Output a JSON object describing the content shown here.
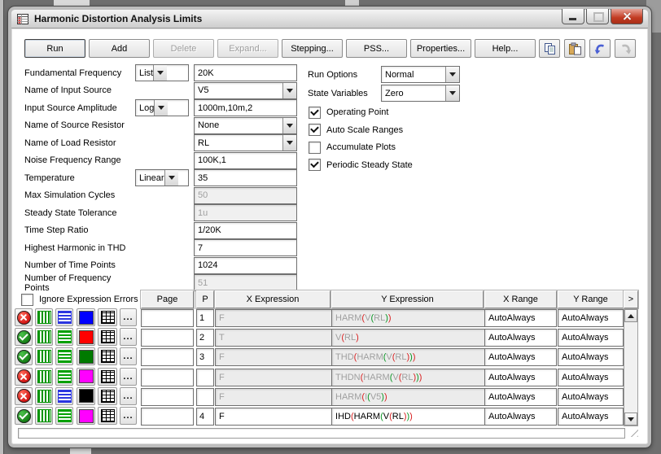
{
  "window": {
    "title": "Harmonic Distortion Analysis Limits"
  },
  "toolbar": {
    "buttons": [
      {
        "label": "Run",
        "enabled": true,
        "default": true
      },
      {
        "label": "Add",
        "enabled": true
      },
      {
        "label": "Delete",
        "enabled": false
      },
      {
        "label": "Expand...",
        "enabled": false
      },
      {
        "label": "Stepping...",
        "enabled": true
      },
      {
        "label": "PSS...",
        "enabled": true
      },
      {
        "label": "Properties...",
        "enabled": true
      },
      {
        "label": "Help...",
        "enabled": true
      }
    ],
    "icon_buttons": [
      {
        "name": "copy",
        "enabled": true
      },
      {
        "name": "paste",
        "enabled": true
      },
      {
        "name": "undo",
        "enabled": true
      },
      {
        "name": "redo",
        "enabled": false
      }
    ]
  },
  "form": {
    "fields": [
      {
        "label": "Fundamental Frequency",
        "method": "List",
        "value": "20K",
        "control": "text",
        "disabled": false
      },
      {
        "label": "Name of Input Source",
        "method": "",
        "value": "V5",
        "control": "select",
        "disabled": false
      },
      {
        "label": "Input Source Amplitude",
        "method": "Log",
        "value": "1000m,10m,2",
        "control": "text",
        "disabled": false
      },
      {
        "label": "Name of Source Resistor",
        "method": "",
        "value": "None",
        "control": "select",
        "disabled": false
      },
      {
        "label": "Name of Load Resistor",
        "method": "",
        "value": "RL",
        "control": "select",
        "disabled": false
      },
      {
        "label": "Noise Frequency Range",
        "method": "",
        "value": "100K,1",
        "control": "text",
        "disabled": false
      },
      {
        "label": "Temperature",
        "method": "Linear",
        "value": "35",
        "control": "text",
        "disabled": false
      },
      {
        "label": "Max Simulation Cycles",
        "method": "",
        "value": "50",
        "control": "text",
        "disabled": true
      },
      {
        "label": "Steady State Tolerance",
        "method": "",
        "value": "1u",
        "control": "text",
        "disabled": true
      },
      {
        "label": "Time Step Ratio",
        "method": "",
        "value": "1/20K",
        "control": "text",
        "disabled": false
      },
      {
        "label": "Highest Harmonic in THD",
        "method": "",
        "value": "7",
        "control": "text",
        "disabled": false
      },
      {
        "label": "Number of Time Points",
        "method": "",
        "value": "1024",
        "control": "text",
        "disabled": false
      },
      {
        "label": "Number of Frequency Points",
        "method": "",
        "value": "51",
        "control": "text",
        "disabled": true
      }
    ],
    "run_options_label": "Run Options",
    "run_options_value": "Normal",
    "state_variables_label": "State Variables",
    "state_variables_value": "Zero",
    "checkboxes": [
      {
        "label": "Operating Point",
        "checked": true
      },
      {
        "label": "Auto Scale Ranges",
        "checked": true
      },
      {
        "label": "Accumulate Plots",
        "checked": false
      },
      {
        "label": "Periodic Steady State",
        "checked": true
      }
    ]
  },
  "table": {
    "ignore_label": "Ignore Expression Errors",
    "ignore_checked": false,
    "columns": {
      "page": "Page",
      "p": "P",
      "x_expression": "X Expression",
      "y_expression": "Y Expression",
      "x_range": "X Range",
      "y_range": "Y Range",
      "more": ">"
    },
    "dots_label": "...",
    "paren_colors": [
      "#d81f1f",
      "#089422"
    ],
    "disabled_text": "#9f9f9f",
    "rows": [
      {
        "enabled": false,
        "hatch_color": "#009400",
        "lines_color": "#2b35e0",
        "curve_color": "#0000ff",
        "page": "",
        "p": "1",
        "x": "F",
        "y": "HARM(V(RL))",
        "x_range": "AutoAlways",
        "y_range": "AutoAlways",
        "active": false
      },
      {
        "enabled": true,
        "hatch_color": "#009400",
        "lines_color": "#00a000",
        "curve_color": "#ff0000",
        "page": "",
        "p": "2",
        "x": "T",
        "y": "V(RL)",
        "x_range": "AutoAlways",
        "y_range": "AutoAlways",
        "active": false
      },
      {
        "enabled": true,
        "hatch_color": "#009400",
        "lines_color": "#00a000",
        "curve_color": "#007a00",
        "page": "",
        "p": "3",
        "x": "F",
        "y": "THD(HARM(V(RL)))",
        "x_range": "AutoAlways",
        "y_range": "AutoAlways",
        "active": false
      },
      {
        "enabled": false,
        "hatch_color": "#009400",
        "lines_color": "#00a000",
        "curve_color": "#ff00ff",
        "page": "",
        "p": "",
        "x": "F",
        "y": "THDN(HARM(V(RL)))",
        "x_range": "AutoAlways",
        "y_range": "AutoAlways",
        "active": false
      },
      {
        "enabled": false,
        "hatch_color": "#009400",
        "lines_color": "#2b35e0",
        "curve_color": "#000000",
        "page": "",
        "p": "",
        "x": "F",
        "y": "HARM(I(V5))",
        "x_range": "AutoAlways",
        "y_range": "AutoAlways",
        "active": false
      },
      {
        "enabled": true,
        "hatch_color": "#009400",
        "lines_color": "#00a000",
        "curve_color": "#ff00ff",
        "page": "",
        "p": "4",
        "x": "F",
        "y": "IHD(HARM(V(RL)))",
        "x_range": "AutoAlways",
        "y_range": "AutoAlways",
        "active": true
      }
    ]
  }
}
